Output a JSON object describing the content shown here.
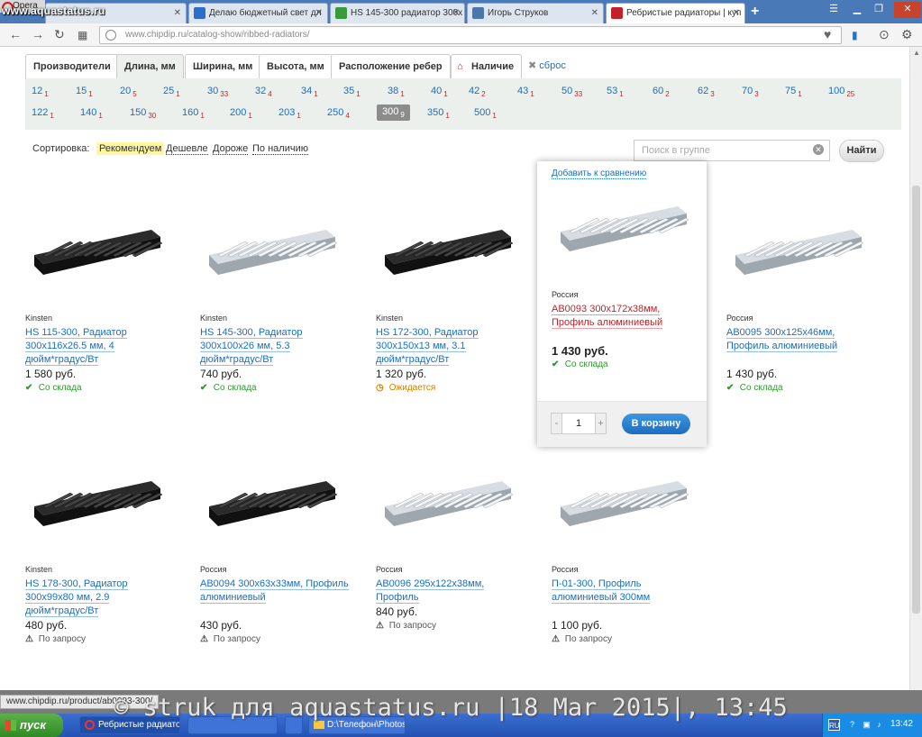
{
  "watermark_top": "www.aquastatus.ru",
  "watermark_bottom": "© struk для aquastatus.ru |18 Mar 2015|, 13:45",
  "browser": {
    "opera_label": "Opera",
    "tabs": [
      {
        "label": "Делаю бюджетный свет дл",
        "color": "#2b6fc7"
      },
      {
        "label": "HS 145-300 радиатор 300х",
        "color": "#3a9a3a"
      },
      {
        "label": "Игорь Струков",
        "color": "#4a76a8"
      },
      {
        "label": "Ребристые радиаторы | куп",
        "color": "#c3212a"
      }
    ],
    "url": "www.chipdip.ru/catalog-show/ribbed-radiators/"
  },
  "filters": {
    "tabs": [
      "Производители",
      "Длина, мм",
      "Ширина, мм",
      "Высота, мм",
      "Расположение ребер",
      "Наличие"
    ],
    "reset": "сброс",
    "lengths": [
      {
        "v": "12",
        "c": "1"
      },
      {
        "v": "15",
        "c": "1"
      },
      {
        "v": "20",
        "c": "5"
      },
      {
        "v": "25",
        "c": "1"
      },
      {
        "v": "30",
        "c": "33"
      },
      {
        "v": "32",
        "c": "4"
      },
      {
        "v": "34",
        "c": "1"
      },
      {
        "v": "35",
        "c": "1"
      },
      {
        "v": "38",
        "c": "1"
      },
      {
        "v": "40",
        "c": "1"
      },
      {
        "v": "42",
        "c": "2"
      },
      {
        "v": "43",
        "c": "1"
      },
      {
        "v": "50",
        "c": "33"
      },
      {
        "v": "53",
        "c": "1"
      },
      {
        "v": "60",
        "c": "2"
      },
      {
        "v": "62",
        "c": "3"
      },
      {
        "v": "70",
        "c": "3"
      },
      {
        "v": "75",
        "c": "1"
      },
      {
        "v": "100",
        "c": "25"
      },
      {
        "v": "122",
        "c": "1"
      },
      {
        "v": "140",
        "c": "1"
      },
      {
        "v": "150",
        "c": "30"
      },
      {
        "v": "160",
        "c": "1"
      },
      {
        "v": "200",
        "c": "1"
      },
      {
        "v": "203",
        "c": "1"
      },
      {
        "v": "250",
        "c": "4"
      },
      {
        "v": "300",
        "c": "9"
      },
      {
        "v": "350",
        "c": "1"
      },
      {
        "v": "500",
        "c": "1"
      }
    ],
    "selected_length": "300"
  },
  "sort": {
    "label": "Сортировка:",
    "options": [
      "Рекомендуем",
      "Дешевле",
      "Дороже",
      "По наличию"
    ],
    "active": "Рекомендуем"
  },
  "search": {
    "placeholder": "Поиск в группе",
    "button": "Найти"
  },
  "hover": {
    "compare": "Добавить к сравнению",
    "qty": "1",
    "cart": "В корзину"
  },
  "products": [
    {
      "brand": "Kinsten",
      "title": "HS 115-300, Радиатор 300х116х26.5 мм, 4 дюйм*градус/Вт",
      "price": "1 580 руб.",
      "stock": "Со склада",
      "status": "ok"
    },
    {
      "brand": "Kinsten",
      "title": "HS 145-300, Радиатор 300х100х26 мм, 5.3 дюйм*градус/Вт",
      "price": "740 руб.",
      "stock": "Со склада",
      "status": "ok"
    },
    {
      "brand": "Kinsten",
      "title": "HS 172-300, Радиатор 300х150х13 мм, 3.1 дюйм*градус/Вт",
      "price": "1 320 руб.",
      "stock": "Ожидается",
      "status": "wait"
    },
    {
      "brand": "Россия",
      "title": "AB0093 300x172x38мм, Профиль алюминиевый",
      "price": "1 430 руб.",
      "stock": "Со склада",
      "status": "ok"
    },
    {
      "brand": "Россия",
      "title": "AB0095 300x125x46мм, Профиль алюминиевый",
      "price": "1 430 руб.",
      "stock": "Со склада",
      "status": "ok"
    },
    {
      "brand": "Kinsten",
      "title": "HS 178-300, Радиатор 300х99х80 мм, 2.9 дюйм*градус/Вт",
      "price": "480 руб.",
      "stock": "По запросу",
      "status": "req"
    },
    {
      "brand": "Россия",
      "title": "AB0094 300x63x33мм, Профиль алюминиевый",
      "price": "430 руб.",
      "stock": "По запросу",
      "status": "req"
    },
    {
      "brand": "Россия",
      "title": "AB0096 295x122x38мм, Профиль",
      "price": "840 руб.",
      "stock": "По запросу",
      "status": "req"
    },
    {
      "brand": "Россия",
      "title": "П-01-300, Профиль алюминиевый 300мм",
      "price": "1 100 руб.",
      "stock": "По запросу",
      "status": "req"
    }
  ],
  "status_url": "www.chipdip.ru/product/ab0093-300/",
  "taskbar": {
    "start": "пуск",
    "tasks": [
      "Ребристые радиато...",
      "",
      "",
      "D:\\Телефон\\Photos"
    ],
    "lang": "RU",
    "time": "13:42"
  }
}
